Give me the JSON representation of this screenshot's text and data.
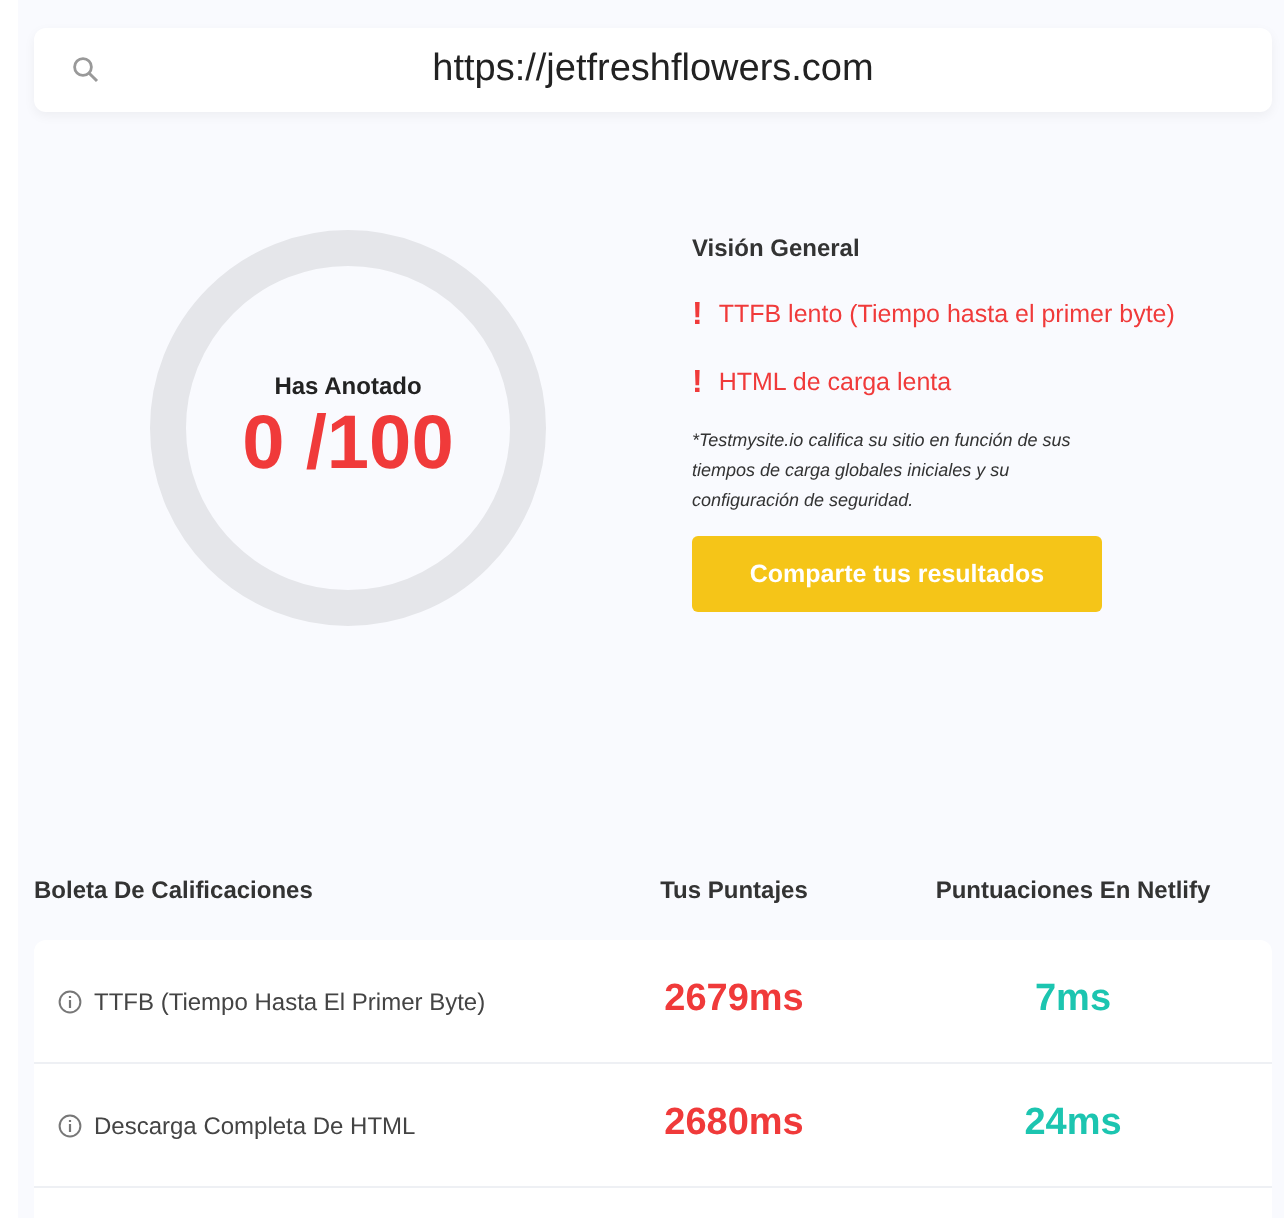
{
  "search": {
    "value": "https://jetfreshflowers.com"
  },
  "score": {
    "label": "Has Anotado",
    "value": "0 /100"
  },
  "overview": {
    "title": "Visión General",
    "issues": [
      {
        "mark": "!",
        "text": "TTFB lento (Tiempo hasta el primer byte)"
      },
      {
        "mark": "!",
        "text": "HTML de carga lenta"
      }
    ],
    "note": "*Testmysite.io califica su sitio en función de sus tiempos de carga globales iniciales y su configuración de seguridad.",
    "button": "Comparte tus resultados"
  },
  "table": {
    "columns": [
      "Boleta De Calificaciones",
      "Tus Puntajes",
      "Puntuaciones En Netlify"
    ],
    "rows": [
      {
        "metric": "TTFB (Tiempo Hasta El Primer Byte)",
        "yours": "2679ms",
        "netlify": "7ms"
      },
      {
        "metric": "Descarga Completa De HTML",
        "yours": "2680ms",
        "netlify": "24ms"
      }
    ]
  }
}
